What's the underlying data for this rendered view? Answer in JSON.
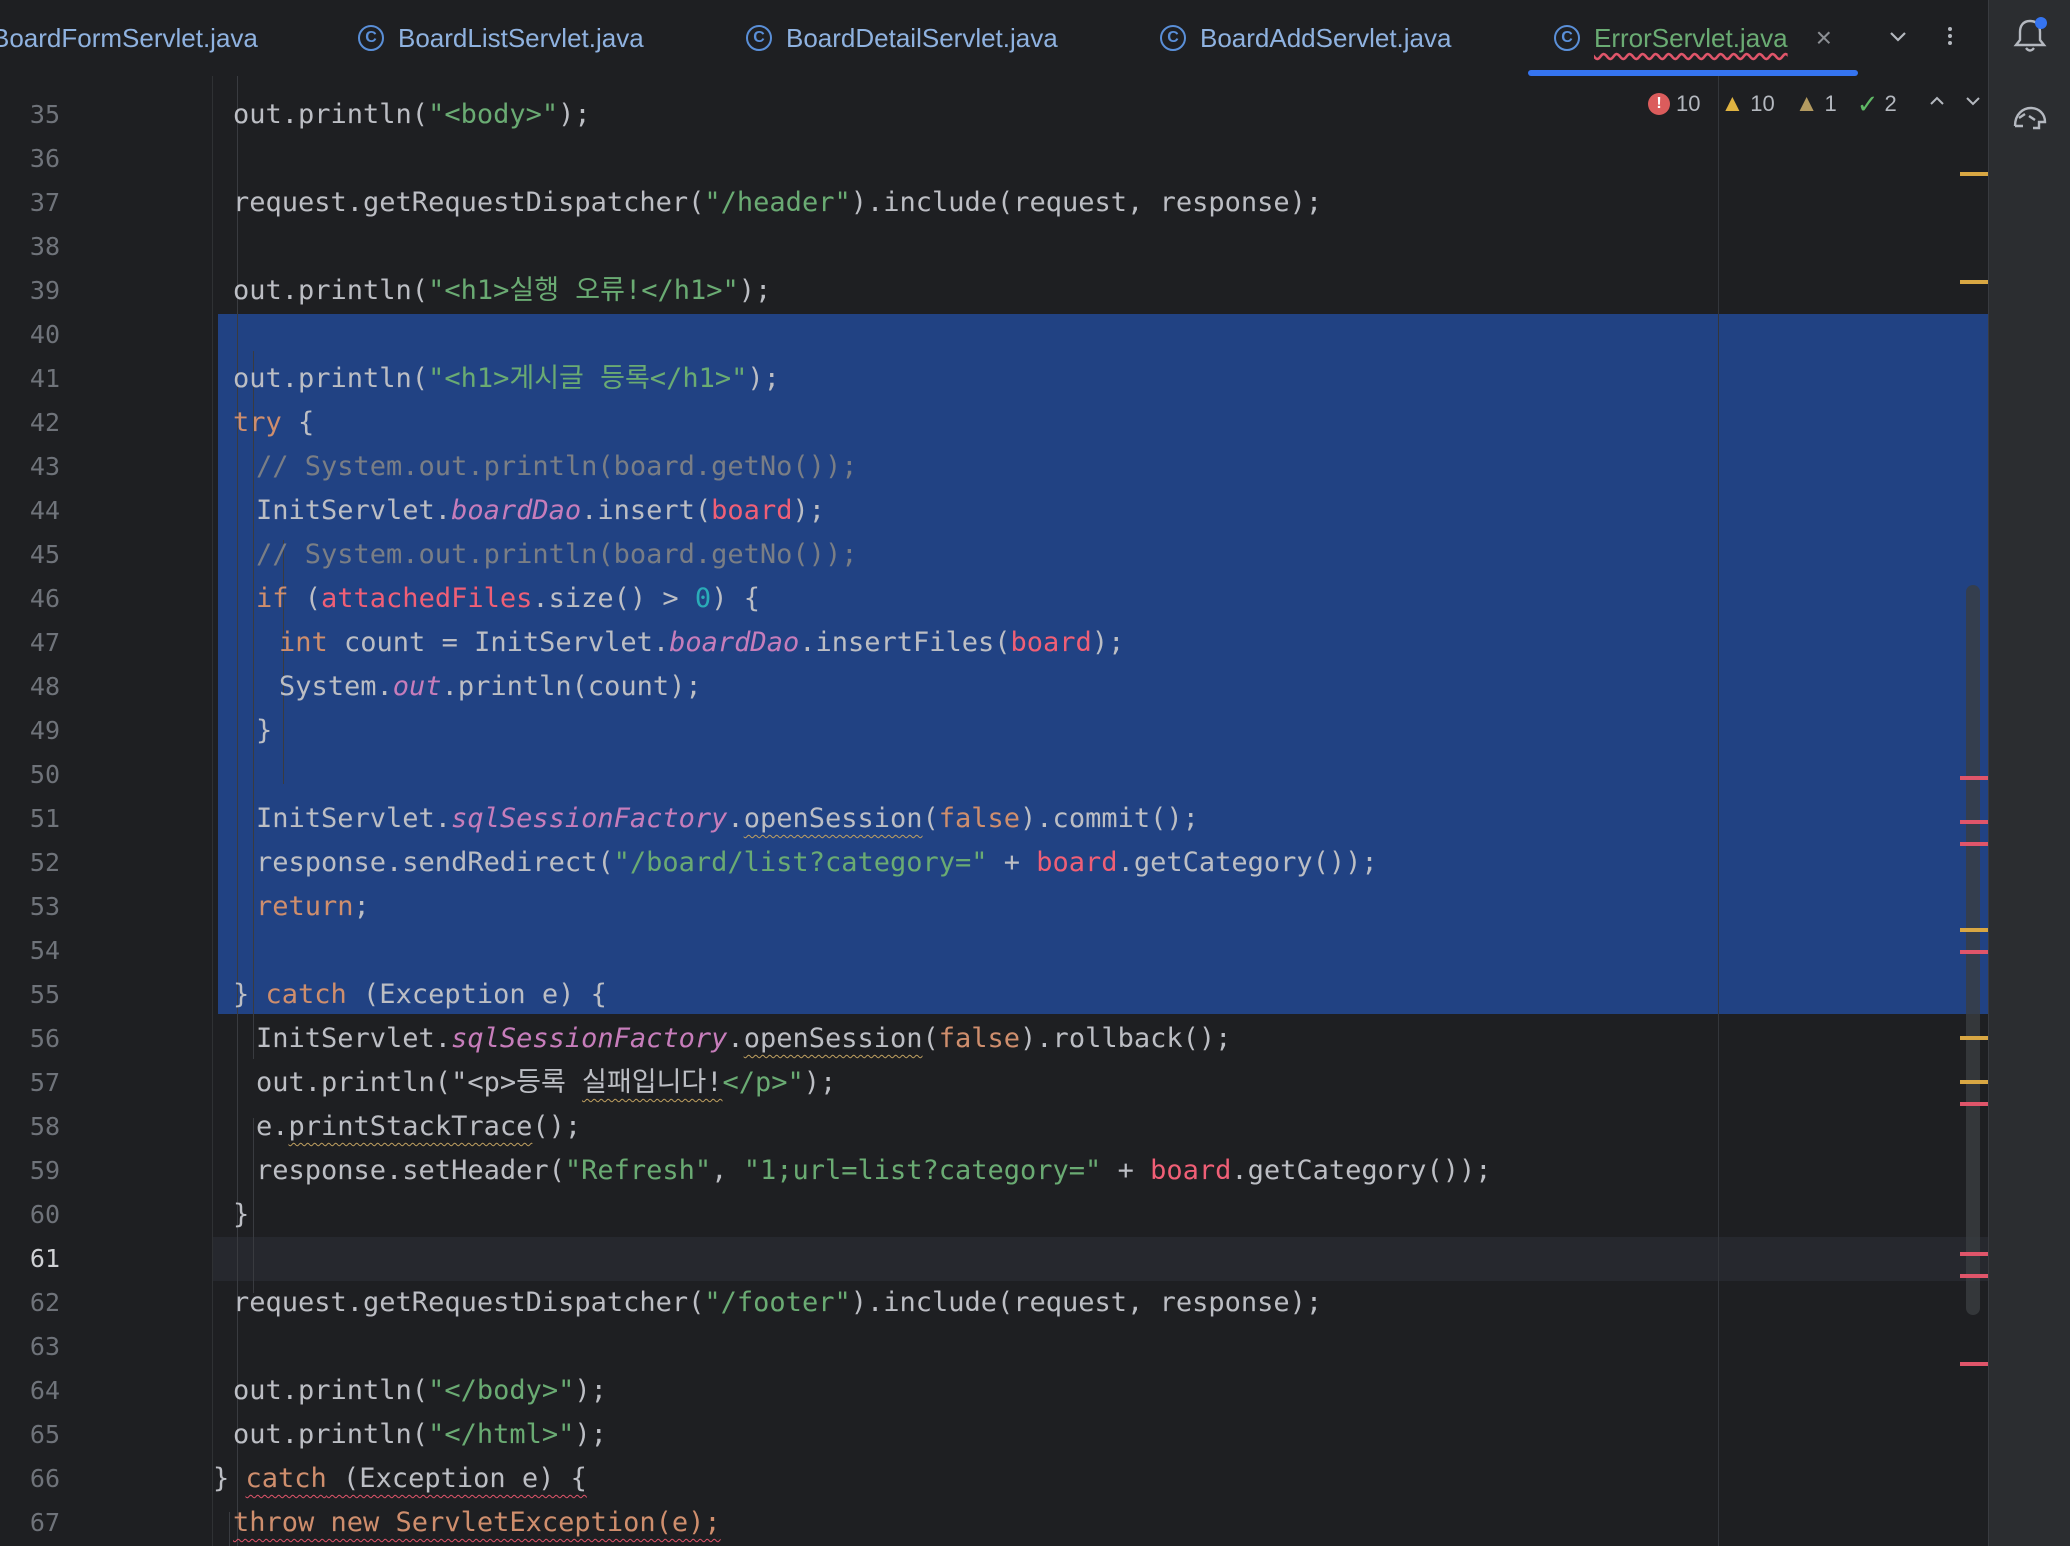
{
  "tabs": [
    {
      "label": "BoardFormServlet.java",
      "active": false,
      "clipped": true
    },
    {
      "label": "BoardListServlet.java",
      "active": false
    },
    {
      "label": "BoardDetailServlet.java",
      "active": false
    },
    {
      "label": "BoardAddServlet.java",
      "active": false
    },
    {
      "label": "ErrorServlet.java",
      "active": true
    }
  ],
  "icons": {
    "tab_class": "class-icon",
    "tab_close": "close-icon",
    "tab_dropdown": "chevron-down-icon",
    "tab_more": "more-vertical-icon",
    "notifications": "bell-icon",
    "ai_assistant": "ai-assistant-icon"
  },
  "inspections": {
    "errors": "10",
    "warnings": "10",
    "weak_warnings": "1",
    "ok": "2"
  },
  "gutter": {
    "line_numbers": [
      "35",
      "36",
      "37",
      "38",
      "39",
      "40",
      "41",
      "42",
      "43",
      "44",
      "45",
      "46",
      "47",
      "48",
      "49",
      "50",
      "51",
      "52",
      "53",
      "54",
      "55",
      "56",
      "57",
      "58",
      "59",
      "60",
      "61",
      "62",
      "63",
      "64",
      "65",
      "66",
      "67"
    ],
    "current_line": "61"
  },
  "code_lines": [
    {
      "n": "35",
      "indent": 2,
      "tokens": [
        {
          "t": "out.println("
        },
        {
          "t": "\"<body>\"",
          "c": "str"
        },
        {
          "t": ");"
        }
      ]
    },
    {
      "n": "36",
      "indent": 0,
      "tokens": []
    },
    {
      "n": "37",
      "indent": 2,
      "tokens": [
        {
          "t": "request.getRequestDispatcher("
        },
        {
          "t": "\"/header\"",
          "c": "str"
        },
        {
          "t": ").include(request, response);"
        }
      ]
    },
    {
      "n": "38",
      "indent": 0,
      "tokens": []
    },
    {
      "n": "39",
      "indent": 2,
      "tokens": [
        {
          "t": "out.println("
        },
        {
          "t": "\"<h1>실행 오류!</h1>\"",
          "c": "str"
        },
        {
          "t": ");"
        }
      ]
    },
    {
      "n": "40",
      "indent": 0,
      "tokens": []
    },
    {
      "n": "41",
      "indent": 2,
      "tokens": [
        {
          "t": "out.println("
        },
        {
          "t": "\"<h1>게시글 등록</h1>\"",
          "c": "str"
        },
        {
          "t": ");"
        }
      ]
    },
    {
      "n": "42",
      "indent": 2,
      "tokens": [
        {
          "t": "try",
          "c": "kw"
        },
        {
          "t": " {"
        }
      ]
    },
    {
      "n": "43",
      "indent": 3,
      "tokens": [
        {
          "t": "// System.out.println(board.getNo());",
          "c": "cmt"
        }
      ]
    },
    {
      "n": "44",
      "indent": 3,
      "tokens": [
        {
          "t": "InitServlet."
        },
        {
          "t": "boardDao",
          "c": "fld"
        },
        {
          "t": ".insert("
        },
        {
          "t": "board",
          "c": "var"
        },
        {
          "t": ");"
        }
      ]
    },
    {
      "n": "45",
      "indent": 3,
      "tokens": [
        {
          "t": "// System.out.println(board.getNo());",
          "c": "cmt"
        }
      ]
    },
    {
      "n": "46",
      "indent": 3,
      "tokens": [
        {
          "t": "if",
          "c": "kw"
        },
        {
          "t": " ("
        },
        {
          "t": "attachedFiles",
          "c": "var"
        },
        {
          "t": ".size() > "
        },
        {
          "t": "0",
          "c": "num"
        },
        {
          "t": ") {"
        }
      ]
    },
    {
      "n": "47",
      "indent": 4,
      "tokens": [
        {
          "t": "int",
          "c": "kw"
        },
        {
          "t": " count = InitServlet."
        },
        {
          "t": "boardDao",
          "c": "fld"
        },
        {
          "t": ".insertFiles("
        },
        {
          "t": "board",
          "c": "var"
        },
        {
          "t": ");"
        }
      ]
    },
    {
      "n": "48",
      "indent": 4,
      "tokens": [
        {
          "t": "System."
        },
        {
          "t": "out",
          "c": "fld"
        },
        {
          "t": ".println(count);"
        }
      ]
    },
    {
      "n": "49",
      "indent": 3,
      "tokens": [
        {
          "t": "}"
        }
      ]
    },
    {
      "n": "50",
      "indent": 0,
      "tokens": []
    },
    {
      "n": "51",
      "indent": 3,
      "tokens": [
        {
          "t": "InitServlet."
        },
        {
          "t": "sqlSessionFactory",
          "c": "fld"
        },
        {
          "t": "."
        },
        {
          "t": "openSession",
          "c": "squig"
        },
        {
          "t": "("
        },
        {
          "t": "false",
          "c": "kw"
        },
        {
          "t": ").commit();"
        }
      ]
    },
    {
      "n": "52",
      "indent": 3,
      "tokens": [
        {
          "t": "response.sendRedirect("
        },
        {
          "t": "\"/board/list?category=\"",
          "c": "str"
        },
        {
          "t": " + "
        },
        {
          "t": "board",
          "c": "var"
        },
        {
          "t": ".getCategory());"
        }
      ]
    },
    {
      "n": "53",
      "indent": 3,
      "tokens": [
        {
          "t": "return",
          "c": "kw"
        },
        {
          "t": ";"
        }
      ]
    },
    {
      "n": "54",
      "indent": 0,
      "tokens": []
    },
    {
      "n": "55",
      "indent": 2,
      "tokens": [
        {
          "t": "} "
        },
        {
          "t": "catch",
          "c": "kw"
        },
        {
          "t": " (Exception e) {"
        }
      ]
    },
    {
      "n": "56",
      "indent": 3,
      "tokens": [
        {
          "t": "InitServlet."
        },
        {
          "t": "sqlSessionFactory",
          "c": "fld"
        },
        {
          "t": "."
        },
        {
          "t": "openSession",
          "c": "squig"
        },
        {
          "t": "("
        },
        {
          "t": "false",
          "c": "kw"
        },
        {
          "t": ").rollback();"
        }
      ]
    },
    {
      "n": "57",
      "indent": 3,
      "tokens": [
        {
          "t": "out.println("
        },
        {
          "t": "\"<p>등록 "
        },
        {
          "t": "실패입니다!",
          "c": "squig"
        },
        {
          "t": "</p>\"",
          "c": "str"
        },
        {
          "t": ");"
        }
      ]
    },
    {
      "n": "58",
      "indent": 3,
      "tokens": [
        {
          "t": "e."
        },
        {
          "t": "printStackTrace",
          "c": "squig"
        },
        {
          "t": "();"
        }
      ]
    },
    {
      "n": "59",
      "indent": 3,
      "tokens": [
        {
          "t": "response.setHeader("
        },
        {
          "t": "\"Refresh\"",
          "c": "str"
        },
        {
          "t": ", "
        },
        {
          "t": "\"1;url=list?category=\"",
          "c": "str"
        },
        {
          "t": " + "
        },
        {
          "t": "board",
          "c": "var"
        },
        {
          "t": ".getCategory());"
        }
      ]
    },
    {
      "n": "60",
      "indent": 2,
      "tokens": [
        {
          "t": "}"
        }
      ]
    },
    {
      "n": "61",
      "indent": 0,
      "tokens": []
    },
    {
      "n": "62",
      "indent": 2,
      "tokens": [
        {
          "t": "request.getRequestDispatcher("
        },
        {
          "t": "\"/footer\"",
          "c": "str"
        },
        {
          "t": ").include(request, response);"
        }
      ]
    },
    {
      "n": "63",
      "indent": 0,
      "tokens": []
    },
    {
      "n": "64",
      "indent": 2,
      "tokens": [
        {
          "t": "out.println("
        },
        {
          "t": "\"</body>\"",
          "c": "str"
        },
        {
          "t": ");"
        }
      ]
    },
    {
      "n": "65",
      "indent": 2,
      "tokens": [
        {
          "t": "out.println("
        },
        {
          "t": "\"</html>\"",
          "c": "str"
        },
        {
          "t": ");"
        }
      ]
    },
    {
      "n": "66",
      "indent": 1,
      "tokens": [
        {
          "t": "} "
        },
        {
          "t": "catch",
          "c": "kw squig-err"
        },
        {
          "t": " (Exception e) {",
          "c": "squig-err"
        }
      ]
    },
    {
      "n": "67",
      "indent": 2,
      "tokens": [
        {
          "t": "throw new ServletException(e);",
          "c": "kw squig-err"
        }
      ]
    }
  ],
  "scroll_markers": [
    {
      "line": "37",
      "type": "warning"
    },
    {
      "line": "39",
      "type": "warning"
    },
    {
      "line": "51",
      "type": "error"
    },
    {
      "line": "52",
      "type": "error"
    },
    {
      "line": "52",
      "type": "error"
    },
    {
      "line": "54",
      "type": "warning"
    },
    {
      "line": "55",
      "type": "error"
    },
    {
      "line": "57",
      "type": "warning"
    },
    {
      "line": "58",
      "type": "warning"
    },
    {
      "line": "58",
      "type": "error"
    },
    {
      "line": "61",
      "type": "error"
    },
    {
      "line": "62",
      "type": "error"
    },
    {
      "line": "64",
      "type": "error"
    }
  ],
  "colors": {
    "error": "#e0556a",
    "warning": "#d9a743",
    "selection": "#214283",
    "accent": "#3574f0"
  }
}
